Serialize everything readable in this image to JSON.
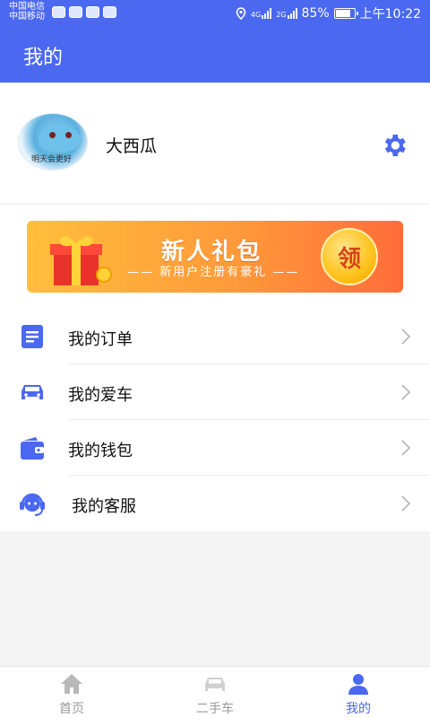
{
  "status_bar": {
    "carrier1": "中国电信",
    "carrier2": "中国移动",
    "net1": "4G",
    "net2": "2G",
    "battery": "85%",
    "time": "上午10:22"
  },
  "header": {
    "title": "我的"
  },
  "profile": {
    "avatar_caption": "明天会更好",
    "username": "大西瓜",
    "settings_icon": "gear-icon"
  },
  "banner": {
    "title": "新人礼包",
    "subtitle": "—— 新用户注册有豪礼 ——",
    "action": "领"
  },
  "menu": [
    {
      "label": "我的订单",
      "icon": "order-list-icon"
    },
    {
      "label": "我的爱车",
      "icon": "car-icon"
    },
    {
      "label": "我的钱包",
      "icon": "wallet-icon"
    },
    {
      "label": "我的客服",
      "icon": "headset-icon"
    }
  ],
  "tabs": [
    {
      "label": "首页",
      "icon": "home-icon",
      "active": false
    },
    {
      "label": "二手车",
      "icon": "car-icon",
      "active": false
    },
    {
      "label": "我的",
      "icon": "person-icon",
      "active": true
    }
  ],
  "colors": {
    "accent": "#4a68f0",
    "inactive": "#9a9a9a",
    "banner_orange": "#ff9a3a"
  }
}
